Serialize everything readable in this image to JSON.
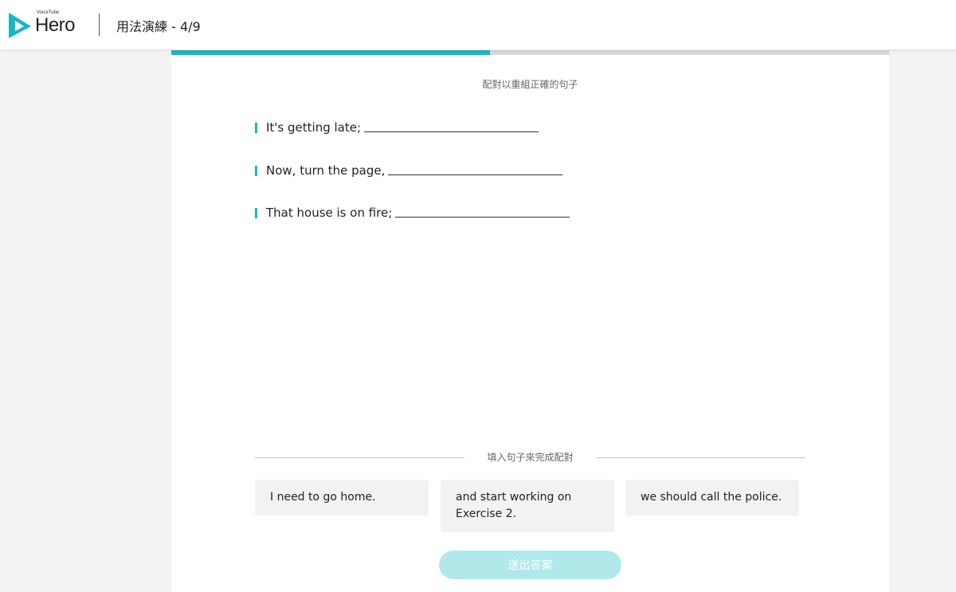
{
  "header": {
    "logo_small": "VoiceTube",
    "logo_main": "Hero",
    "title": "用法演練 - 4/9"
  },
  "progress": {
    "current": 4,
    "total": 9,
    "fraction": 0.444
  },
  "instruction": "配對以重組正確的句子",
  "sentences": [
    {
      "text": "It's getting late;"
    },
    {
      "text": "Now, turn the page,"
    },
    {
      "text": "That house is on fire;"
    }
  ],
  "fill_label": "填入句子來完成配對",
  "options": [
    {
      "text": "I need to go home."
    },
    {
      "text": "and start working on Exercise 2."
    },
    {
      "text": "we should call the police."
    }
  ],
  "submit_label": "送出答案",
  "colors": {
    "accent": "#17b7c2",
    "submit_disabled": "#b1e9ea",
    "option_bg": "#f2f2f2",
    "page_bg": "#f3f3f3"
  }
}
